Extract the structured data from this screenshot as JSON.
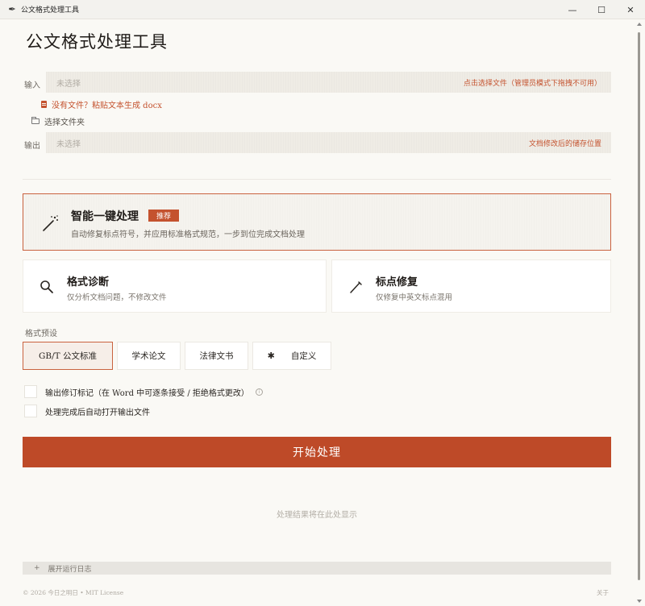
{
  "window": {
    "title": "公文格式处理工具",
    "minimize_glyph": "—",
    "maximize_glyph": "☐",
    "close_glyph": "✕"
  },
  "page_title": "公文格式处理工具",
  "input": {
    "label": "输入",
    "placeholder": "未选择",
    "hint": "点击选择文件（管理员模式下拖拽不可用）",
    "no_file_link": "没有文件？粘贴文本生成 docx",
    "choose_folder": "选择文件夹"
  },
  "output": {
    "label": "输出",
    "placeholder": "未选择",
    "hint": "文档修改后的储存位置"
  },
  "smart": {
    "title": "智能一键处理",
    "badge": "推荐",
    "desc": "自动修复标点符号，并应用标准格式规范，一步到位完成文档处理"
  },
  "diagnose": {
    "title": "格式诊断",
    "desc": "仅分析文档问题，不修改文件"
  },
  "punct": {
    "title": "标点修复",
    "desc": "仅修复中英文标点混用"
  },
  "presets": {
    "label": "格式预设",
    "items": [
      "GB/T 公文标准",
      "学术论文",
      "法律文书",
      "自定义"
    ]
  },
  "options": {
    "track_changes": "输出修订标记（在 Word 中可逐条接受 / 拒绝格式更改）",
    "auto_open": "处理完成后自动打开输出文件"
  },
  "start_button": "开始处理",
  "result_placeholder": "处理结果将在此处显示",
  "log_toggle": "展开运行日志",
  "footer": {
    "copyright": "© 2026 今日之明日 • MIT License",
    "about": "关于"
  },
  "colors": {
    "accent": "#c4522e",
    "button": "#be4a28",
    "background": "#faf9f5"
  }
}
